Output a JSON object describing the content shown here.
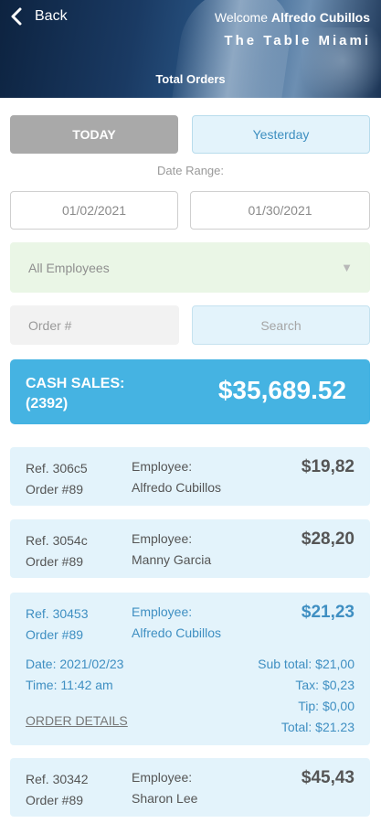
{
  "header": {
    "back_label": "Back",
    "welcome_prefix": "Welcome",
    "user_name": "Alfredo Cubillos",
    "restaurant": "The Table Miami",
    "title": "Total Orders"
  },
  "filters": {
    "today_label": "TODAY",
    "yesterday_label": "Yesterday",
    "date_range_label": "Date Range:",
    "date_from": "01/02/2021",
    "date_to": "01/30/2021",
    "employee_selected": "All Employees",
    "order_placeholder": "Order #",
    "search_label": "Search"
  },
  "cash_sales": {
    "label": "CASH SALES:",
    "count": "(2392)",
    "amount": "$35,689.52"
  },
  "orders": [
    {
      "ref": "Ref. 306c5",
      "order": "Order #89",
      "employee_label": "Employee:",
      "employee": "Alfredo Cubillos",
      "amount": "$19,82"
    },
    {
      "ref": "Ref. 3054c",
      "order": "Order #89",
      "employee_label": "Employee:",
      "employee": "Manny Garcia",
      "amount": "$28,20"
    },
    {
      "ref": "Ref. 30453",
      "order": "Order #89",
      "employee_label": "Employee:",
      "employee": "Alfredo Cubillos",
      "amount": "$21,23",
      "date": "Date: 2021/02/23",
      "time": "Time: 11:42 am",
      "subtotal": "Sub total: $21,00",
      "tax": "Tax: $0,23",
      "tip": "Tip: $0,00",
      "total": "Total: $21.23",
      "details_label": "ORDER DETAILS"
    },
    {
      "ref": "Ref. 30342",
      "order": "Order #89",
      "employee_label": "Employee:",
      "employee": "Sharon Lee",
      "amount": "$45,43"
    }
  ],
  "icons": {
    "back": "chevron-left-icon",
    "dropdown": "caret-down-icon"
  },
  "colors": {
    "accent": "#45b3e2",
    "card_bg": "#e3f3fb",
    "expanded_text": "#3f8fc2"
  }
}
